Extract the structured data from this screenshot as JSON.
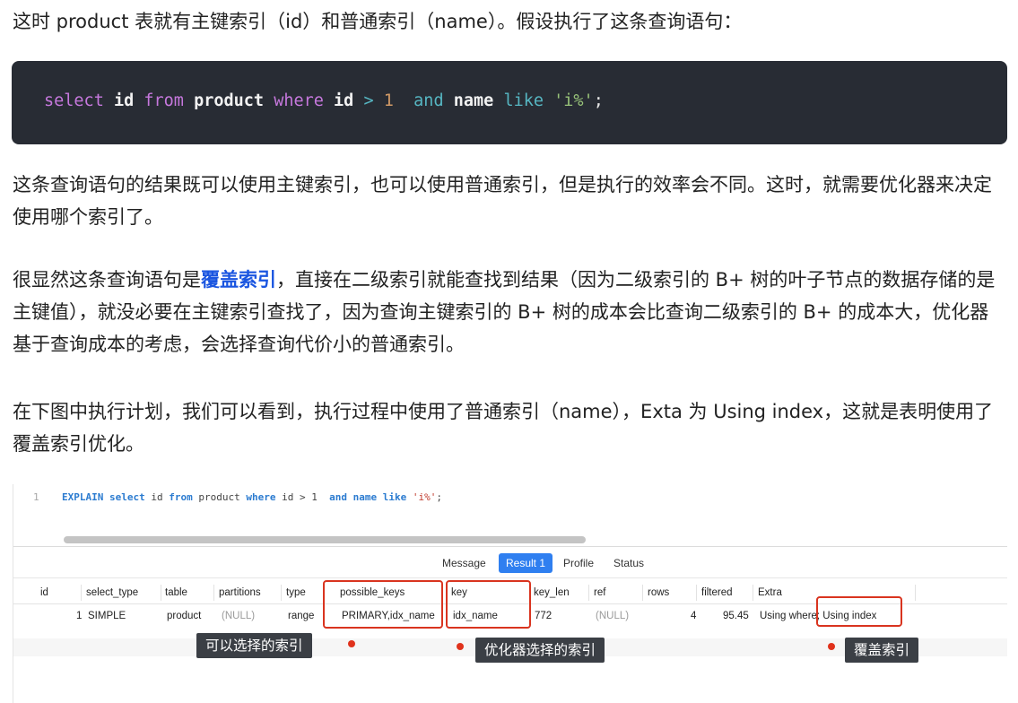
{
  "paragraphs": {
    "p1": "这时 product 表就有主键索引（id）和普通索引（name）。假设执行了这条查询语句：",
    "p2": "这条查询语句的结果既可以使用主键索引，也可以使用普通索引，但是执行的效率会不同。这时，就需要优化器来决定使用哪个索引了。",
    "p3_before": "很显然这条查询语句是",
    "p3_link": "覆盖索引",
    "p3_after": "，直接在二级索引就能查找到结果（因为二级索引的 B+ 树的叶子节点的数据存储的是主键值），就没必要在主键索引查找了，因为查询主键索引的 B+ 树的成本会比查询二级索引的 B+ 的成本大，优化器基于查询成本的考虑，会选择查询代价小的普通索引。",
    "p4": "在下图中执行计划，我们可以看到，执行过程中使用了普通索引（name），Exta 为 Using index，这就是表明使用了覆盖索引优化。"
  },
  "code": {
    "select": "select",
    "id": "id",
    "from": "from",
    "table": "product",
    "where": "where",
    "id2": "id",
    "gt": ">",
    "one": "1",
    "and": "and",
    "name": "name",
    "like": "like",
    "pattern": "'i%'",
    "semicolon": ";"
  },
  "editor": {
    "line_number": "1",
    "explain": "EXPLAIN",
    "select": "select",
    "id": "id",
    "from": "from",
    "table": "product",
    "where": "where",
    "cond1": "id > 1",
    "and": "and",
    "name": "name",
    "like": "like",
    "pattern": "'i%'",
    "semicolon": ";"
  },
  "tabs": [
    {
      "label": "Message",
      "active": false
    },
    {
      "label": "Result 1",
      "active": true
    },
    {
      "label": "Profile",
      "active": false
    },
    {
      "label": "Status",
      "active": false
    }
  ],
  "grid": {
    "headers": [
      "id",
      "select_type",
      "table",
      "partitions",
      "type",
      "possible_keys",
      "key",
      "key_len",
      "ref",
      "rows",
      "filtered",
      "Extra"
    ],
    "row": {
      "id": "1",
      "select_type": "SIMPLE",
      "table": "product",
      "partitions": "(NULL)",
      "type": "range",
      "possible_keys": "PRIMARY,idx_name",
      "key": "idx_name",
      "key_len": "772",
      "ref": "(NULL)",
      "rows": "4",
      "filtered": "95.45",
      "extra": "Using where; Using index"
    }
  },
  "annotations": {
    "possible_keys_label": "可以选择的索引",
    "key_label": "优化器选择的索引",
    "extra_label": "覆盖索引"
  },
  "colors": {
    "accent": "#2f7ff0",
    "highlight": "#d9341f",
    "code_bg": "#282c34",
    "link": "#1a55e0"
  }
}
